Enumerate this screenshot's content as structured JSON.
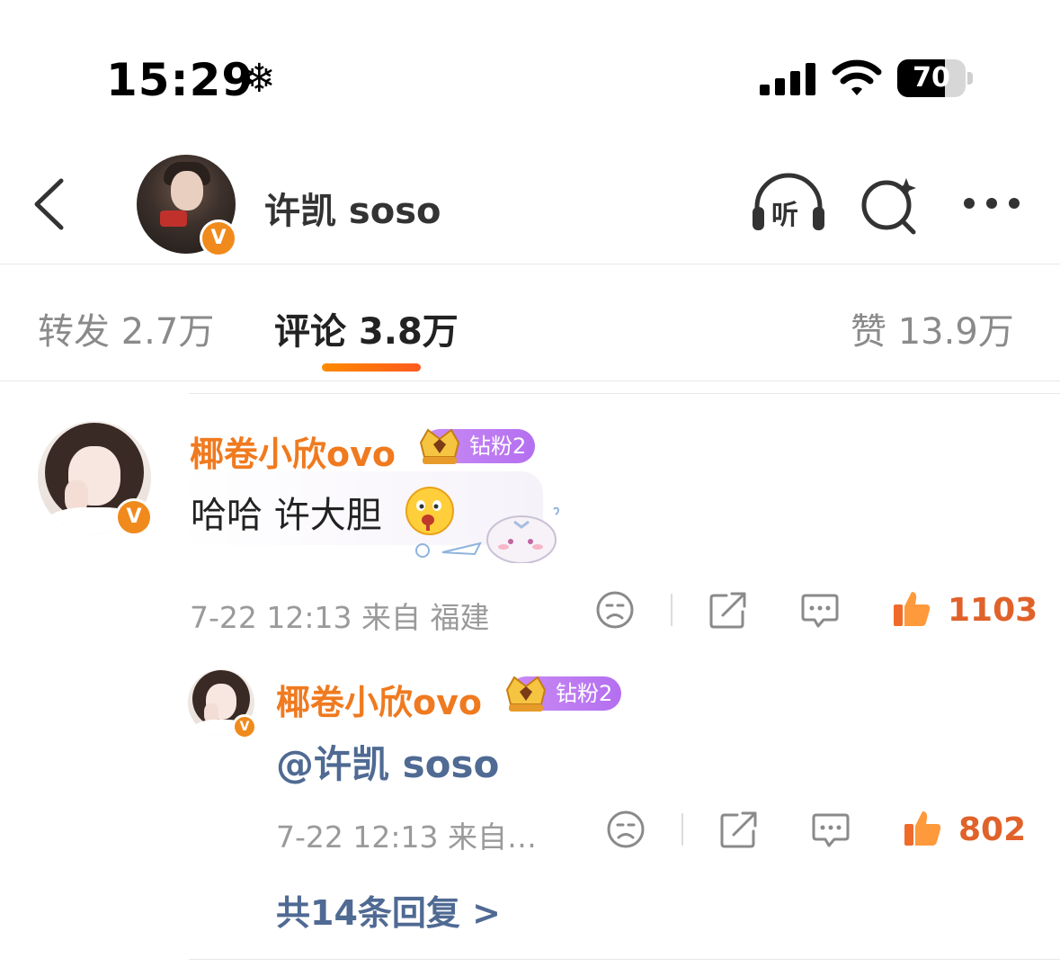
{
  "status_bar": {
    "time": "15:29",
    "snow_glyph": "❄",
    "battery": "70",
    "battery_level": 0.7
  },
  "header": {
    "title": "许凯 soso",
    "listen_label": "听",
    "verified_mark": "V"
  },
  "tabs": [
    {
      "label": "转发 2.7万",
      "active": false
    },
    {
      "label": "评论 3.8万",
      "active": true
    },
    {
      "label": "赞 13.9万",
      "active": false
    }
  ],
  "comment": {
    "username": "椰卷小欣ovo",
    "fan_badge": "钻粉2",
    "text": "哈哈 许大胆",
    "meta": "7-22 12:13 来自 福建",
    "likes": "1103",
    "verified_mark": "V"
  },
  "reply": {
    "username": "椰卷小欣ovo",
    "fan_badge": "钻粉2",
    "text": "@许凯 soso",
    "meta": "7-22 12:13 来自…",
    "likes": "802",
    "verified_mark": "V"
  },
  "replies_link": "共14条回复 >",
  "colors": {
    "accent_orange": "#f07a1f",
    "like_red": "#e0622a",
    "link_blue": "#4f6a93",
    "badge_purple": "#b46ff0"
  },
  "icons": [
    "back-icon",
    "listen-icon",
    "search-icon",
    "more-icon",
    "snow-icon",
    "signal-icon",
    "wifi-icon",
    "battery-icon",
    "crown-icon",
    "dislike-icon",
    "share-icon",
    "comment-icon",
    "like-icon",
    "emoji-icon",
    "sticker-icon"
  ]
}
